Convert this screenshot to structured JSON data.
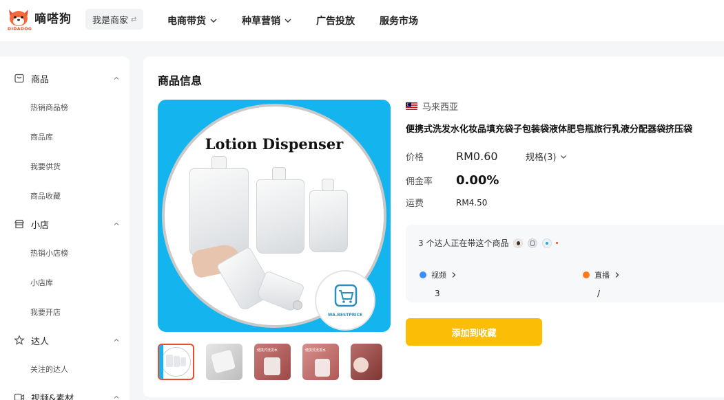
{
  "brand": {
    "name": "嘀嗒狗",
    "sub": "DIDADOG"
  },
  "header": {
    "merchant_label": "我是商家",
    "nav": [
      "电商带货",
      "种草营销",
      "广告投放",
      "服务市场"
    ]
  },
  "sidebar": {
    "groups": [
      {
        "label": "商品",
        "icon": "product-icon",
        "items": [
          "热销商品榜",
          "商品库",
          "我要供货",
          "商品收藏"
        ]
      },
      {
        "label": "小店",
        "icon": "shop-icon",
        "items": [
          "热销小店榜",
          "小店库",
          "我要开店"
        ]
      },
      {
        "label": "达人",
        "icon": "star-icon",
        "items": [
          "关注的达人"
        ]
      },
      {
        "label": "视频&素材",
        "icon": "video-icon",
        "items": []
      }
    ]
  },
  "main": {
    "section_title": "商品信息",
    "hero_title": "Lotion Dispenser",
    "hero_badge": "WA.BESTPRICE",
    "thumb_label_3": "便携式洗发水",
    "thumb_label_4": "便携式洗发水",
    "country": "马来西亚",
    "product_title": "便携式洗发水化妆品填充袋子包装袋液体肥皂瓶旅行乳液分配器袋挤压袋",
    "price_label": "价格",
    "price_value": "RM0.60",
    "spec_label": "规格(3)",
    "commission_label": "佣金率",
    "commission_value": "0.00%",
    "shipping_label": "运费",
    "shipping_value": "RM4.50",
    "promo_text": "3 个达人正在带这个商品",
    "video_label": "视频",
    "video_value": "3",
    "live_label": "直播",
    "live_value": "/",
    "add_button": "添加到收藏"
  },
  "colors": {
    "accent": "#fbbd06",
    "brand": "#e84a2b",
    "hero_bg": "#14b4ee"
  }
}
